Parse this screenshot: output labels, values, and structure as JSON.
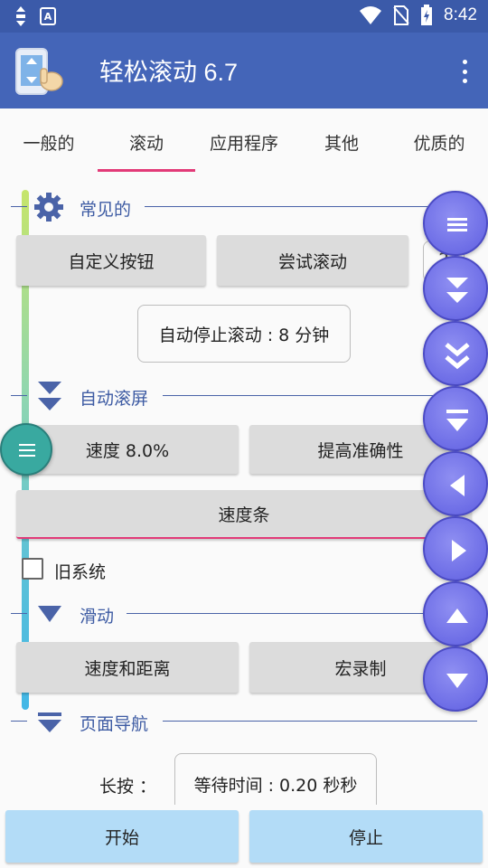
{
  "status_bar": {
    "time": "8:42"
  },
  "app_bar": {
    "title": "轻松滚动 6.7"
  },
  "tabs": [
    "一般的",
    "滚动",
    "应用程序",
    "其他",
    "优质的"
  ],
  "sections": {
    "common": {
      "title": "常见的",
      "custom_button": "自定义按钮",
      "try_scroll": "尝试滚动",
      "help": "?",
      "auto_stop": "自动停止滚动 : 8 分钟"
    },
    "auto_scroll": {
      "title": "自动滚屏",
      "speed": "速度 8.0%",
      "accuracy": "提高准确性",
      "speed_bar": "速度条",
      "old_system": "旧系统"
    },
    "swipe": {
      "title": "滑动",
      "speed_distance": "速度和距离",
      "macro": "宏录制"
    },
    "page_nav": {
      "title": "页面导航",
      "long_press_label": "长按 ：",
      "wait_time": "等待时间 : 0.20 秒秒"
    }
  },
  "bottom": {
    "start": "开始",
    "stop": "停止"
  },
  "colors": {
    "status_bar": "#3b5aa9",
    "app_bar": "#4465b8",
    "accent": "#e23a78",
    "fab": "#6d6de6",
    "bottom_button": "#b3dcf7"
  }
}
